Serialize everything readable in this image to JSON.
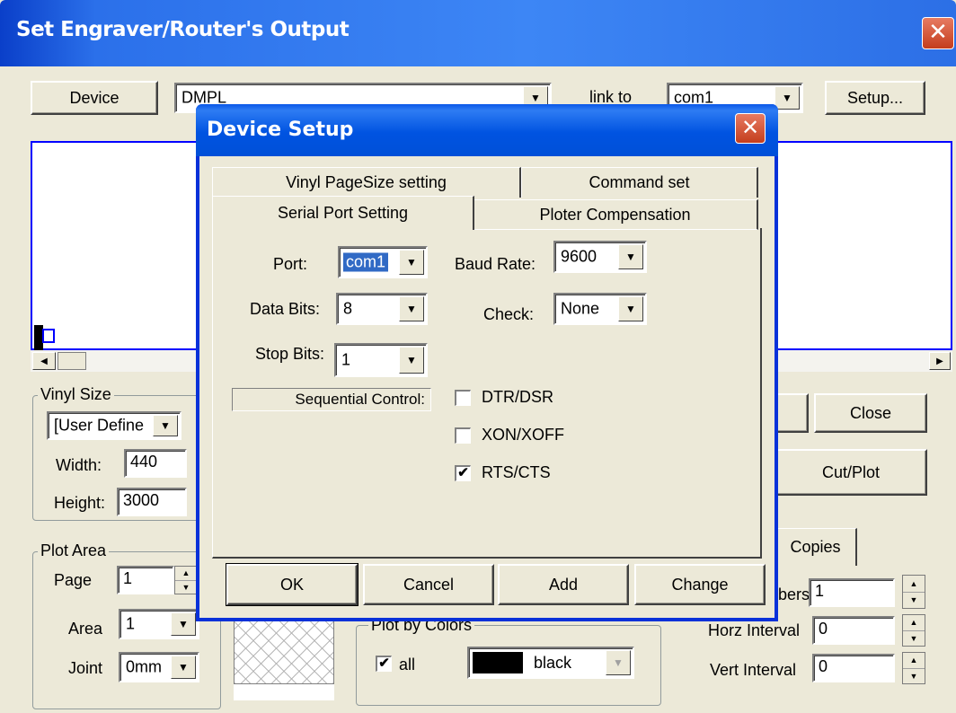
{
  "main_window": {
    "title": "Set Engraver/Router's Output",
    "close_glyph": "✕",
    "device_button": "Device",
    "device_value": "DMPL",
    "link_to_label": "link to",
    "link_to_value": "com1",
    "setup_button": "Setup...",
    "close_button": "Close",
    "cut_plot_button": "Cut/Plot",
    "vinyl_size": {
      "title": "Vinyl Size",
      "preset": "[User Define",
      "width_label": "Width:",
      "width_value": "440",
      "height_label": "Height:",
      "height_value": "3000"
    },
    "plot_area": {
      "title": "Plot Area",
      "page_label": "Page",
      "page_value": "1",
      "area_label": "Area",
      "area_value": "1",
      "joint_label": "Joint",
      "joint_value": "0mm"
    },
    "plot_by_colors": {
      "title": "Plot by Colors",
      "all_label": "all",
      "all_checked": true,
      "color_name": "black",
      "color_swatch": "#000000"
    },
    "copies": {
      "tab_label": "Copies",
      "numbers_label": "bers",
      "numbers_value": "1",
      "horz_label": "Horz Interval",
      "horz_value": "0",
      "vert_label": "Vert Interval",
      "vert_value": "0"
    }
  },
  "dialog": {
    "title": "Device Setup",
    "close_glyph": "✕",
    "tabs_back": [
      "Vinyl PageSize setting",
      "Command set"
    ],
    "tabs_front": [
      "Serial Port Setting",
      "Ploter Compensation"
    ],
    "active_tab": "Serial Port Setting",
    "port_label": "Port:",
    "port_value": "com1",
    "baud_label": "Baud Rate:",
    "baud_value": "9600",
    "data_bits_label": "Data Bits:",
    "data_bits_value": "8",
    "check_label": "Check:",
    "check_value": "None",
    "stop_bits_label": "Stop Bits:",
    "stop_bits_value": "1",
    "sequential_label": "Sequential Control:",
    "options": [
      {
        "label": "DTR/DSR",
        "checked": false
      },
      {
        "label": "XON/XOFF",
        "checked": false
      },
      {
        "label": "RTS/CTS",
        "checked": true
      }
    ],
    "buttons": {
      "ok": "OK",
      "cancel": "Cancel",
      "add": "Add",
      "change": "Change"
    }
  },
  "colors": {
    "title_bar": "#2b70ea",
    "dialog_border": "#0831d9",
    "window_bg": "#ece9d8",
    "preview_border": "#0000ff",
    "selection": "#316ac5"
  }
}
